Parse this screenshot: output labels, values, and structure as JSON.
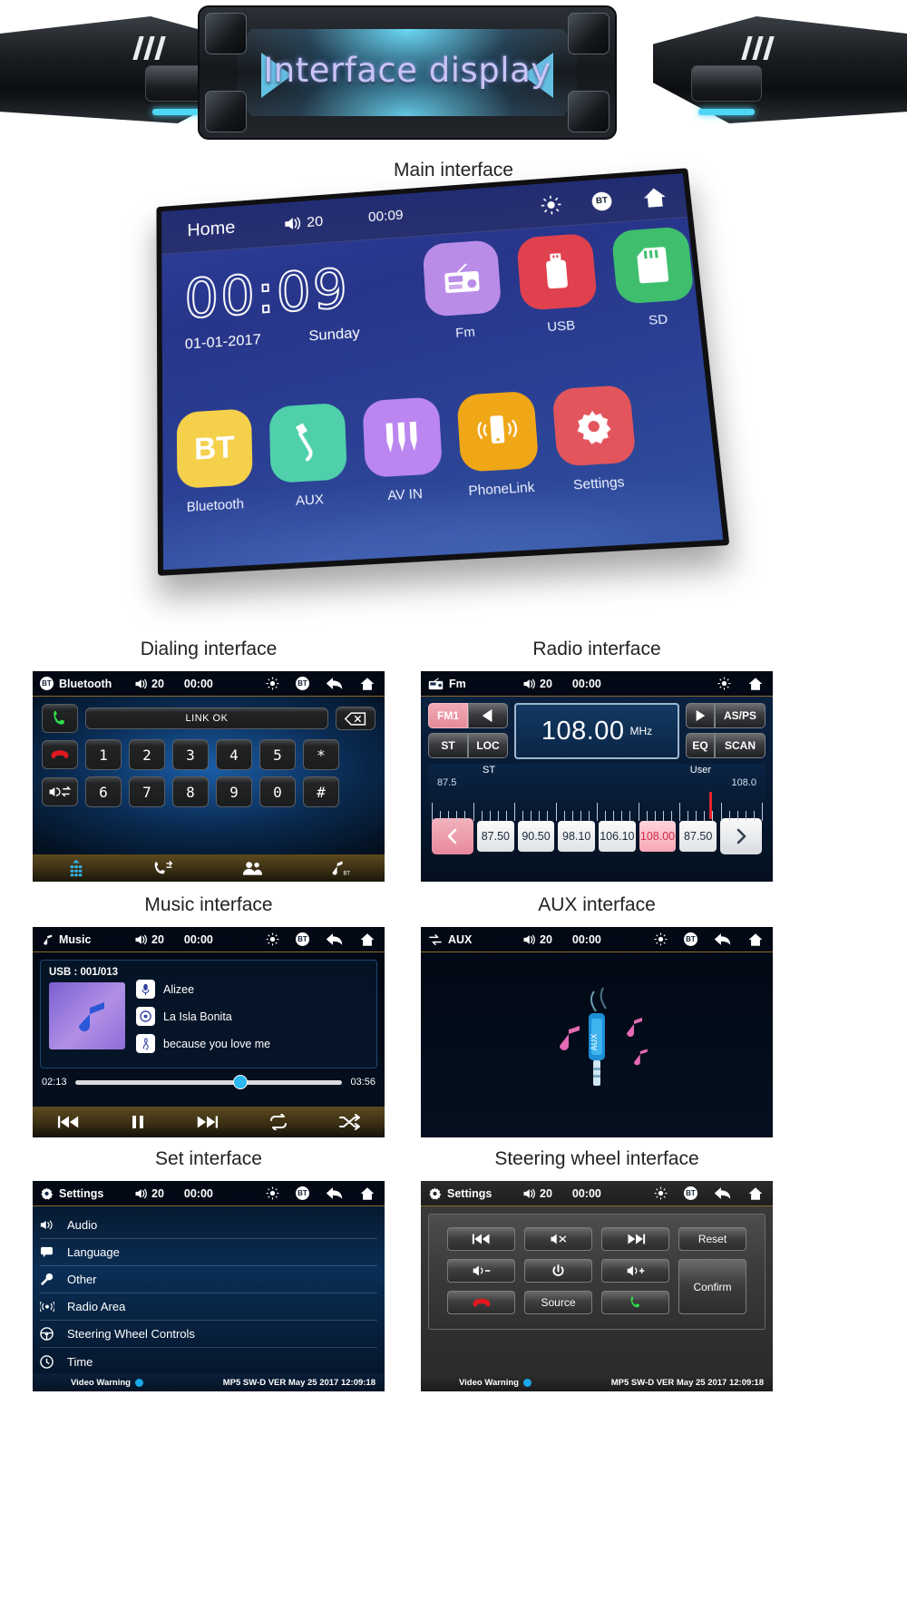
{
  "banner": {
    "title": "Interface display"
  },
  "sections": {
    "main": "Main interface",
    "dialing": "Dialing interface",
    "radio": "Radio interface",
    "music": "Music interface",
    "aux": "AUX interface",
    "set": "Set interface",
    "steering": "Steering wheel interface"
  },
  "main_interface": {
    "topbar": {
      "home_label": "Home",
      "volume": "20",
      "time": "00:09",
      "icons": [
        "brightness-icon",
        "bt-icon",
        "home-icon"
      ]
    },
    "clock": {
      "hours": "00",
      "sep": ":",
      "minutes": "09",
      "date": "01-01-2017",
      "weekday": "Sunday"
    },
    "apps_row1": [
      {
        "label": "Fm",
        "icon": "radio-icon",
        "color": "#b98ce8"
      },
      {
        "label": "USB",
        "icon": "usb-icon",
        "color": "#e0414f"
      },
      {
        "label": "SD",
        "icon": "sdcard-icon",
        "color": "#3fbf6e"
      }
    ],
    "apps_row2": [
      {
        "label": "Bluetooth",
        "icon": "bt-icon",
        "color": "#f5d04a",
        "glyph": "BT"
      },
      {
        "label": "AUX",
        "icon": "aux-plug-icon",
        "color": "#4fd0ab",
        "glyph": ""
      },
      {
        "label": "AV IN",
        "icon": "av-rca-icon",
        "color": "#bb86ef",
        "glyph": ""
      },
      {
        "label": "PhoneLink",
        "icon": "phonelink-icon",
        "color": "#efa617",
        "glyph": ""
      },
      {
        "label": "Settings",
        "icon": "gear-icon",
        "color": "#e2555c",
        "glyph": ""
      }
    ]
  },
  "dialing": {
    "topbar": {
      "title": "Bluetooth",
      "icon": "bt-icon",
      "volume": "20",
      "time": "00:00"
    },
    "field_value": "LINK OK",
    "backspace_icon": "backspace-icon",
    "call_icon": "call-answer-icon",
    "hangup_icon": "call-end-icon",
    "mic_icon": "speaker-swap-icon",
    "keys_row1": [
      "1",
      "2",
      "3",
      "4",
      "5",
      "*"
    ],
    "keys_row2": [
      "6",
      "7",
      "8",
      "9",
      "0",
      "#"
    ],
    "tabs": [
      "dialpad-icon",
      "call-log-icon",
      "contacts-icon",
      "bt-music-icon"
    ]
  },
  "radio": {
    "topbar": {
      "title": "Fm",
      "icon": "radio-icon",
      "volume": "20",
      "time": "00:00"
    },
    "band": "FM1",
    "prev_icon": "prev-arrow-icon",
    "st_label": "ST",
    "loc_label": "LOC",
    "frequency": "108.00",
    "unit": "MHz",
    "asps_label": "AS/PS",
    "play_icon": "play-icon",
    "eq_label": "EQ",
    "scan_label": "SCAN",
    "scale_left_label": "ST",
    "scale_right_label": "User",
    "scale_min": "87.5",
    "scale_max": "108.0",
    "needle_pct": 84,
    "presets": [
      "87.50",
      "90.50",
      "98.10",
      "106.10",
      "108.00",
      "87.50"
    ],
    "active_preset_index": 4,
    "nav_prev_icon": "chevron-left-icon",
    "nav_next_icon": "chevron-right-icon"
  },
  "music": {
    "topbar": {
      "title": "Music",
      "icon": "music-note-icon",
      "volume": "20",
      "time": "00:00"
    },
    "source": "USB : 001/013",
    "artist": "Alizee",
    "album": "La Isla Bonita",
    "track": "because you love me",
    "artist_icon": "microphone-icon",
    "album_icon": "disc-icon",
    "track_icon": "clef-icon",
    "elapsed": "02:13",
    "duration": "03:56",
    "progress_pct": 62,
    "controls": [
      "prev-track-icon",
      "pause-icon",
      "next-track-icon",
      "repeat-icon",
      "shuffle-icon"
    ]
  },
  "aux": {
    "topbar": {
      "title": "AUX",
      "icon": "aux-icon",
      "volume": "20",
      "time": "00:00"
    },
    "plug_label": "AUX"
  },
  "settings": {
    "topbar": {
      "title": "Settings",
      "icon": "gear-icon",
      "volume": "20",
      "time": "00:00"
    },
    "items": [
      {
        "label": "Audio",
        "icon": "speaker-icon"
      },
      {
        "label": "Language",
        "icon": "chat-icon"
      },
      {
        "label": "Other",
        "icon": "wrench-icon"
      },
      {
        "label": "Radio Area",
        "icon": "antenna-icon"
      },
      {
        "label": "Steering Wheel Controls",
        "icon": "steering-icon"
      },
      {
        "label": "Time",
        "icon": "clock-icon"
      }
    ],
    "statusbar": {
      "warning": "Video Warning",
      "version": "MP5 SW-D VER May 25 2017 12:09:18"
    }
  },
  "steering": {
    "topbar": {
      "title": "Settings",
      "icon": "gear-icon",
      "volume": "20",
      "time": "00:00"
    },
    "buttons": [
      {
        "label": "",
        "icon": "prev-track-icon"
      },
      {
        "label": "",
        "icon": "mute-icon"
      },
      {
        "label": "",
        "icon": "next-track-icon"
      },
      {
        "label": "Reset",
        "icon": ""
      },
      {
        "label": "",
        "icon": "volume-down-icon"
      },
      {
        "label": "",
        "icon": "power-icon"
      },
      {
        "label": "",
        "icon": "volume-up-icon"
      },
      {
        "label": "Confirm",
        "icon": ""
      },
      {
        "label": "",
        "icon": "call-end-icon"
      },
      {
        "label": "Source",
        "icon": ""
      },
      {
        "label": "",
        "icon": "call-answer-icon"
      }
    ],
    "statusbar": {
      "warning": "Video Warning",
      "version": "MP5 SW-D VER May 25 2017 12:09:18"
    }
  }
}
